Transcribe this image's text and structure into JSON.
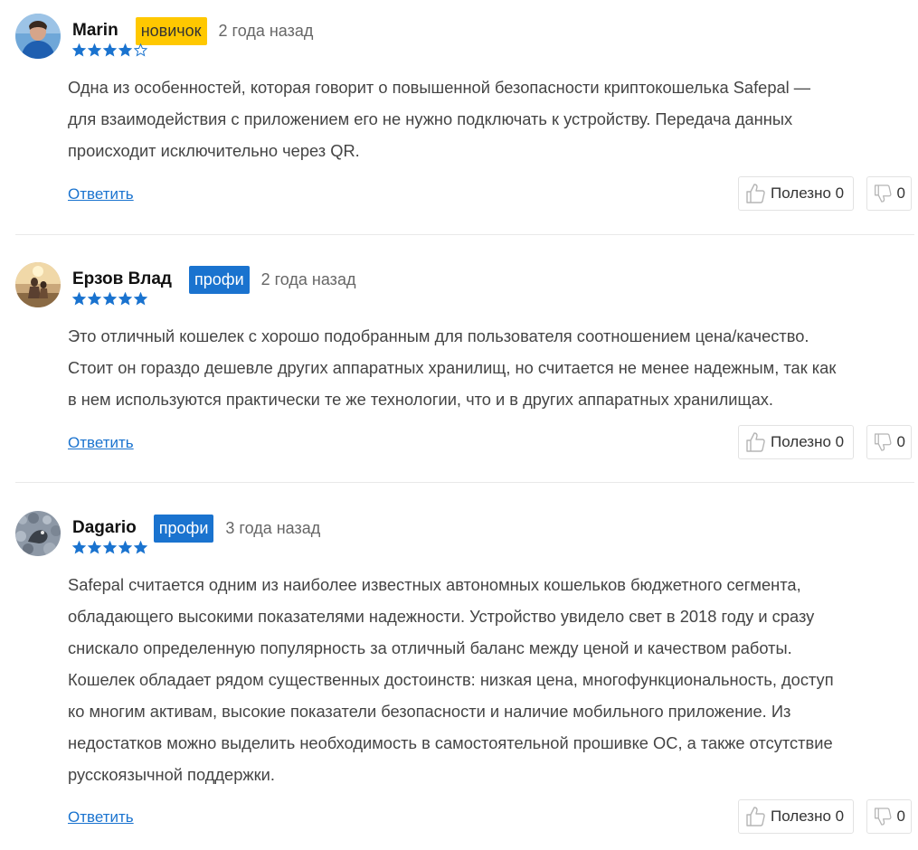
{
  "reviews": [
    {
      "author": "Marin",
      "badge": "новичок",
      "badge_type": "novice",
      "date": "2 года назад",
      "rating": 4,
      "rating_max": 5,
      "lines": [
        "Одна из особенностей, которая говорит о повышенной безопасности криптокошелька Safepal —",
        "для взаимодействия с приложением его не нужно подключать к устройству. Передача данных",
        "происходит исключительно через QR."
      ],
      "reply_label": "Ответить",
      "helpful_label": "Полезно 0",
      "dislike_count": "0"
    },
    {
      "author": "Ерзов Влад",
      "badge": "профи",
      "badge_type": "pro",
      "date": "2 года назад",
      "rating": 5,
      "rating_max": 5,
      "lines": [
        "Это отличный кошелек с хорошо подобранным для пользователя соотношением цена/качество.",
        "Стоит он гораздо дешевле других аппаратных хранилищ, но считается не менее надежным, так как",
        "в нем используются практически те же технологии, что и в других аппаратных хранилищах."
      ],
      "reply_label": "Ответить",
      "helpful_label": "Полезно 0",
      "dislike_count": "0"
    },
    {
      "author": "Dagario",
      "badge": "профи",
      "badge_type": "pro",
      "date": "3 года назад",
      "rating": 5,
      "rating_max": 5,
      "lines": [
        "Safepal считается одним из наиболее известных автономных кошельков бюджетного сегмента,",
        "обладающего высокими показателями надежности. Устройство увидело свет в 2018 году и сразу",
        "снискало определенную популярность за отличный баланс между ценой и качеством работы.",
        "Кошелек обладает рядом существенных достоинств: низкая цена, многофункциональность, доступ",
        "ко многим активам, высокие показатели безопасности и наличие мобильного приложение. Из",
        "недостатков можно выделить необходимость в самостоятельной прошивке ОС, а также отсутствие",
        "русскоязычной поддержки."
      ],
      "reply_label": "Ответить",
      "helpful_label": "Полезно 0",
      "dislike_count": "0"
    }
  ],
  "colors": {
    "accent": "#1a73cf",
    "novice_badge": "#ffc800",
    "star": "#1a73cf"
  },
  "icons": {
    "like": "thumbs-up-icon",
    "dislike": "thumbs-down-icon",
    "star": "star-icon"
  }
}
